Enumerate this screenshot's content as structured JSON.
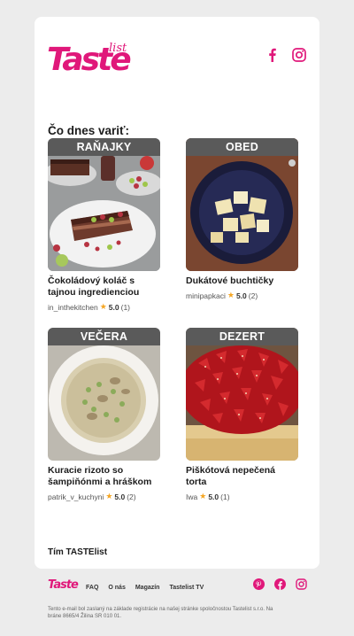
{
  "brand": {
    "logo_text": "Taste",
    "logo_sub": "list",
    "accent": "#e0187a"
  },
  "social_top": [
    "facebook-icon",
    "instagram-icon"
  ],
  "greeting": "Čo dnes variť:",
  "recipes": [
    {
      "category": "RAŇAJKY",
      "title": "Čokoládový koláč s tajnou ingredienciou",
      "author": "in_inthekitchen",
      "rating": "5.0",
      "reviews": "(1)"
    },
    {
      "category": "OBED",
      "title": "Dukátové buchtičky",
      "author": "minipapkaci",
      "rating": "5.0",
      "reviews": "(2)"
    },
    {
      "category": "VEČERA",
      "title": "Kuracie rizoto so šampiňónmi a hráškom",
      "author": "patrik_v_kuchyni",
      "rating": "5.0",
      "reviews": "(2)"
    },
    {
      "category": "DEZERT",
      "title": "Piškótová nepečená torta",
      "author": "Iwa",
      "rating": "5.0",
      "reviews": "(1)"
    }
  ],
  "signature": "Tím TASTElist",
  "footer": {
    "logo_text": "Taste",
    "nav": [
      "FAQ",
      "O nás",
      "Magazín",
      "Tastelist TV"
    ],
    "social": [
      "pinterest-icon",
      "facebook-icon",
      "instagram-icon"
    ],
    "legal": "Tento e-mail bol zaslaný na základe registrácie na našej stránke spoločnostou Tastelist s.r.o. Na bráne 8665/4 Žilina SR 010 01."
  }
}
